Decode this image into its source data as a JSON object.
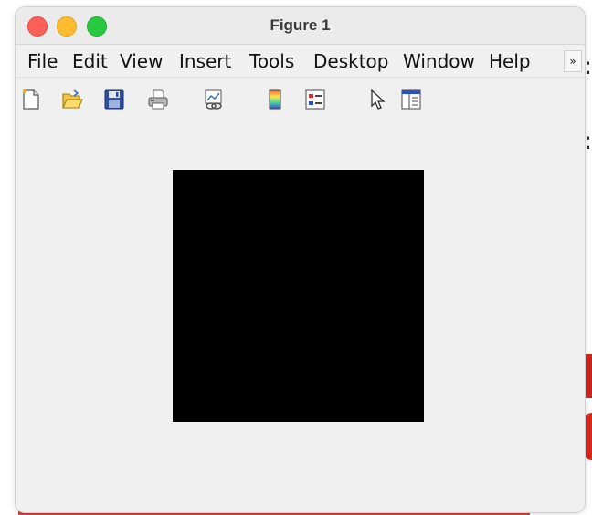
{
  "window": {
    "title": "Figure 1"
  },
  "menubar": {
    "items": [
      {
        "label": "File"
      },
      {
        "label": "Edit"
      },
      {
        "label": "View"
      },
      {
        "label": "Insert"
      },
      {
        "label": "Tools"
      },
      {
        "label": "Desktop"
      },
      {
        "label": "Window"
      },
      {
        "label": "Help"
      }
    ],
    "overflow_icon": "chevron-double-right-icon"
  },
  "toolbar": {
    "buttons": [
      {
        "icon": "new-figure-icon"
      },
      {
        "icon": "open-file-icon"
      },
      {
        "icon": "save-icon"
      },
      {
        "icon": "print-icon"
      },
      {
        "icon": "link-plot-icon"
      },
      {
        "icon": "insert-colorbar-icon"
      },
      {
        "icon": "insert-legend-icon"
      },
      {
        "icon": "edit-plot-icon"
      },
      {
        "icon": "property-inspector-icon"
      }
    ]
  },
  "figure": {
    "image_fill_color": "#000000",
    "background_color": "#f0f0f0"
  },
  "colors": {
    "close": "#fe5f57",
    "minimize": "#febc2e",
    "maximize": "#28c840"
  }
}
